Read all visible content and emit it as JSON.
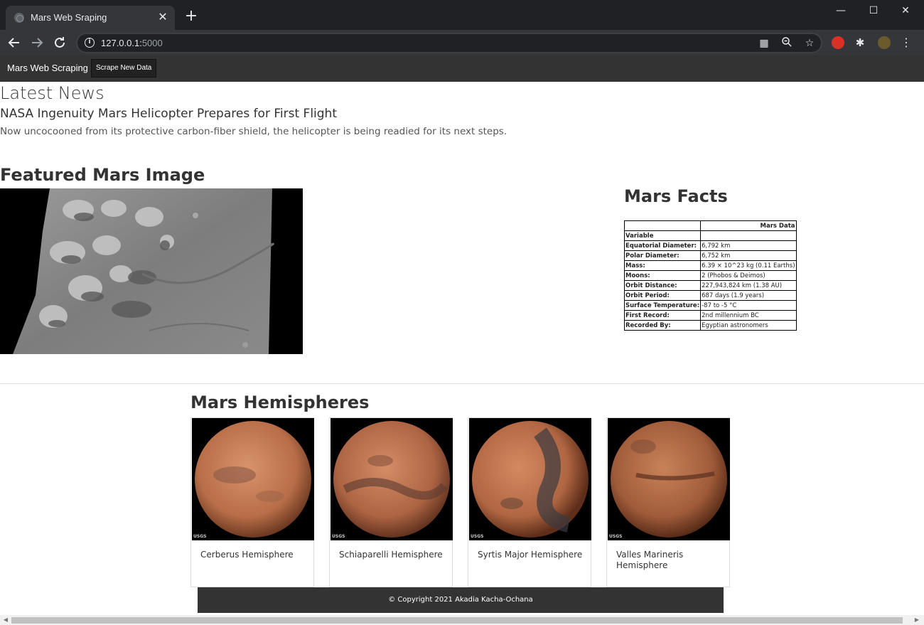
{
  "browser": {
    "tab_title": "Mars Web Sraping",
    "url_host": "127.0.0.1:",
    "url_port": "5000",
    "new_tab": "+",
    "close_tab": "✕",
    "minimize": "—",
    "maximize": "☐",
    "close_window": "✕"
  },
  "nav": {
    "brand": "Mars Web Scraping",
    "scrape_button": "Scrape New Data"
  },
  "news": {
    "heading": "Latest News",
    "title": "NASA Ingenuity Mars Helicopter Prepares for First Flight",
    "paragraph": "Now uncocooned from its protective carbon-fiber shield, the helicopter is being readied for its next steps."
  },
  "featured": {
    "heading": "Featured Mars Image"
  },
  "facts": {
    "heading": "Mars Facts",
    "column_header": "Mars Data",
    "index_label": "Variable",
    "rows": [
      {
        "k": "Equatorial Diameter:",
        "v": "6,792 km"
      },
      {
        "k": "Polar Diameter:",
        "v": "6,752 km"
      },
      {
        "k": "Mass:",
        "v": "6.39 × 10^23 kg (0.11 Earths)"
      },
      {
        "k": "Moons:",
        "v": "2 (Phobos & Deimos)"
      },
      {
        "k": "Orbit Distance:",
        "v": "227,943,824 km (1.38 AU)"
      },
      {
        "k": "Orbit Period:",
        "v": "687 days (1.9 years)"
      },
      {
        "k": "Surface Temperature:",
        "v": "-87 to -5 °C"
      },
      {
        "k": "First Record:",
        "v": "2nd millennium BC"
      },
      {
        "k": "Recorded By:",
        "v": "Egyptian astronomers"
      }
    ]
  },
  "hemispheres": {
    "heading": "Mars Hemispheres",
    "items": [
      {
        "label": "Cerberus Hemisphere"
      },
      {
        "label": "Schiaparelli Hemisphere"
      },
      {
        "label": "Syrtis Major Hemisphere"
      },
      {
        "label": "Valles Marineris Hemisphere"
      }
    ],
    "usgs": "USGS"
  },
  "footer": {
    "text": "© Copyright 2021 Akadia Kacha-Ochana"
  },
  "icons": {
    "back": "arrow-left-icon",
    "forward": "arrow-right-icon",
    "reload": "reload-icon",
    "info": "info-icon",
    "star": "star-icon",
    "extensions": "puzzle-icon",
    "menu": "kebab-menu-icon"
  }
}
